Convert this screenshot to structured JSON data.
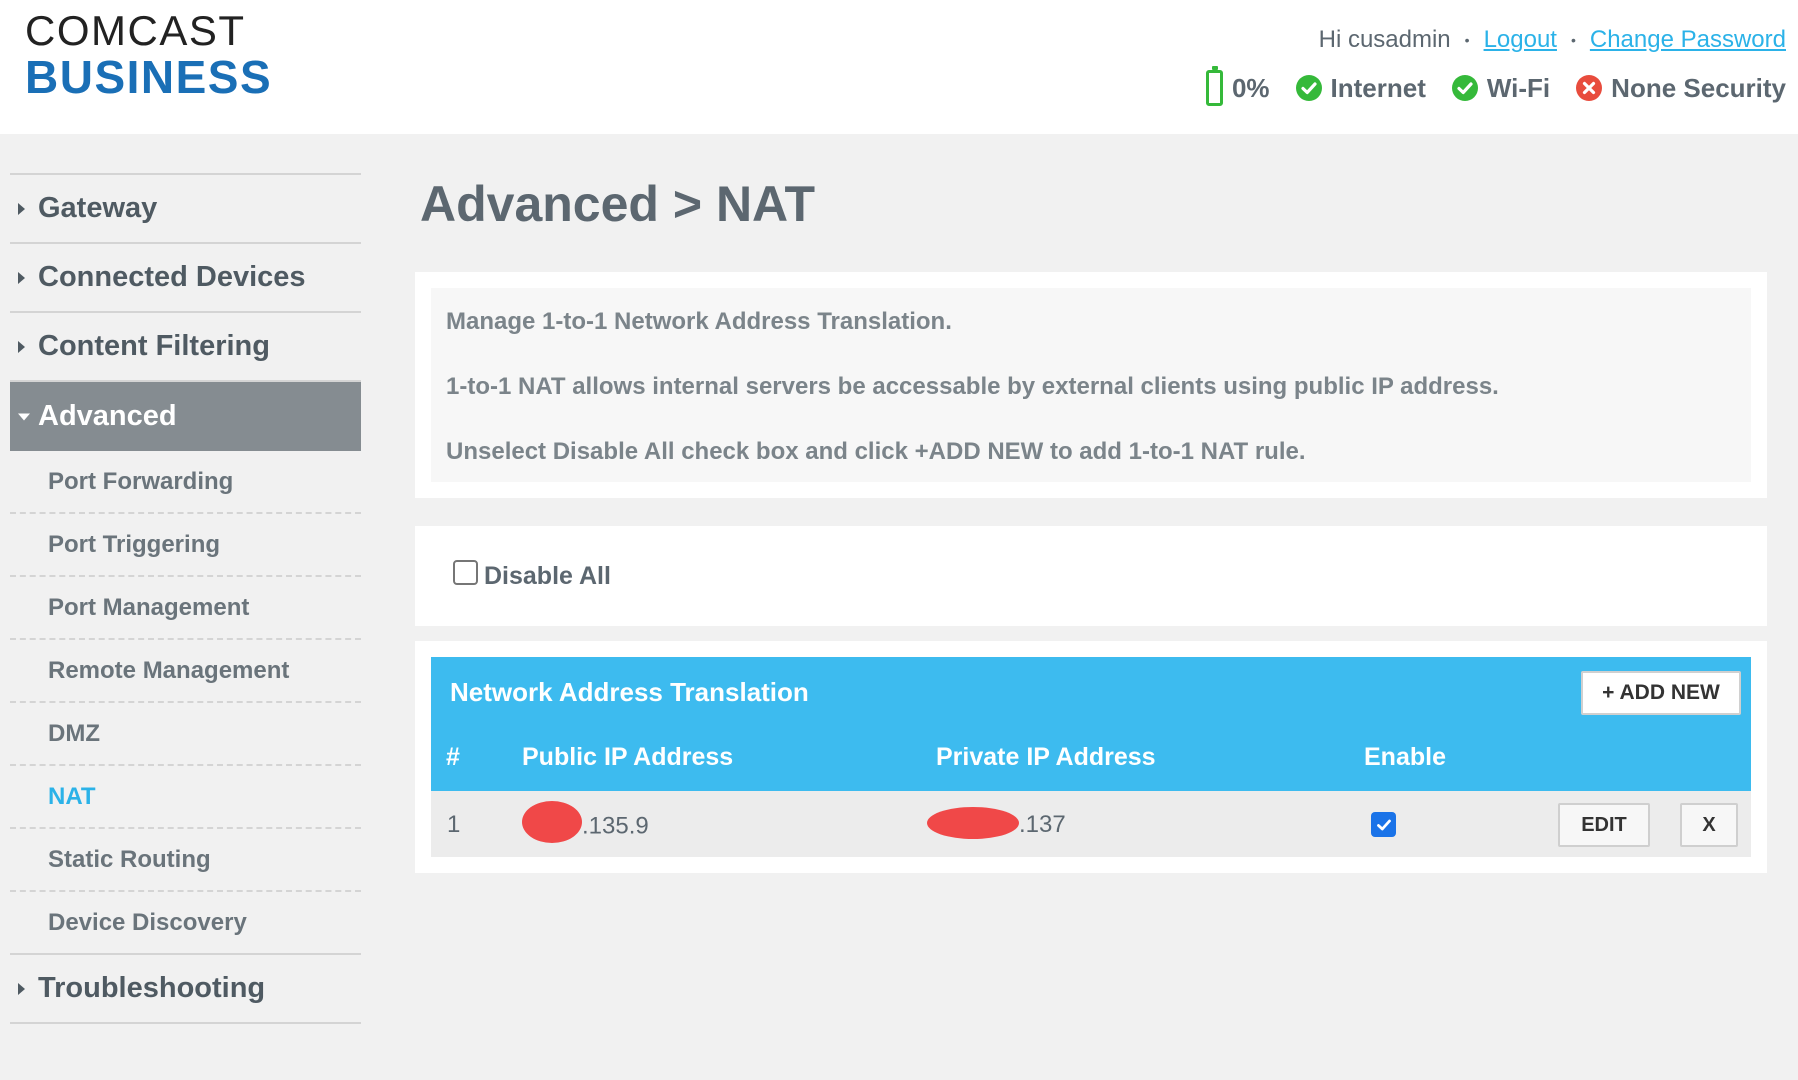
{
  "brand": {
    "line1": "COMCAST",
    "line2": "BUSINESS"
  },
  "header": {
    "greeting": "Hi cusadmin",
    "logout": "Logout",
    "change_password": "Change Password",
    "separator": "•",
    "battery": "0%",
    "internet": "Internet",
    "wifi": "Wi-Fi",
    "security": "None Security",
    "colors": {
      "ok": "#35b93a",
      "error": "#e84c3d",
      "link": "#2bb2e8"
    }
  },
  "sidebar": {
    "sections": [
      {
        "label": "Gateway"
      },
      {
        "label": "Connected Devices"
      },
      {
        "label": "Content Filtering"
      },
      {
        "label": "Advanced"
      },
      {
        "label": "Troubleshooting"
      }
    ],
    "advanced_items": [
      {
        "label": "Port Forwarding"
      },
      {
        "label": "Port Triggering"
      },
      {
        "label": "Port Management"
      },
      {
        "label": "Remote Management"
      },
      {
        "label": "DMZ"
      },
      {
        "label": "NAT"
      },
      {
        "label": "Static Routing"
      },
      {
        "label": "Device Discovery"
      }
    ]
  },
  "main": {
    "title": "Advanced > NAT",
    "info": [
      "Manage 1-to-1 Network Address Translation.",
      "1-to-1 NAT allows internal servers be accessable by external clients using public IP address.",
      "Unselect Disable All check box and click +ADD NEW to add 1-to-1 NAT rule."
    ],
    "disable_all": "Disable All",
    "table": {
      "title": "Network Address Translation",
      "add_new": "+ ADD NEW",
      "columns": [
        "#",
        "Public IP Address",
        "Private IP Address",
        "Enable"
      ],
      "rows": [
        {
          "num": "1",
          "public_ip": ".135.9",
          "private_ip": ".137",
          "enabled": true,
          "edit": "EDIT",
          "delete": "X"
        }
      ]
    }
  }
}
